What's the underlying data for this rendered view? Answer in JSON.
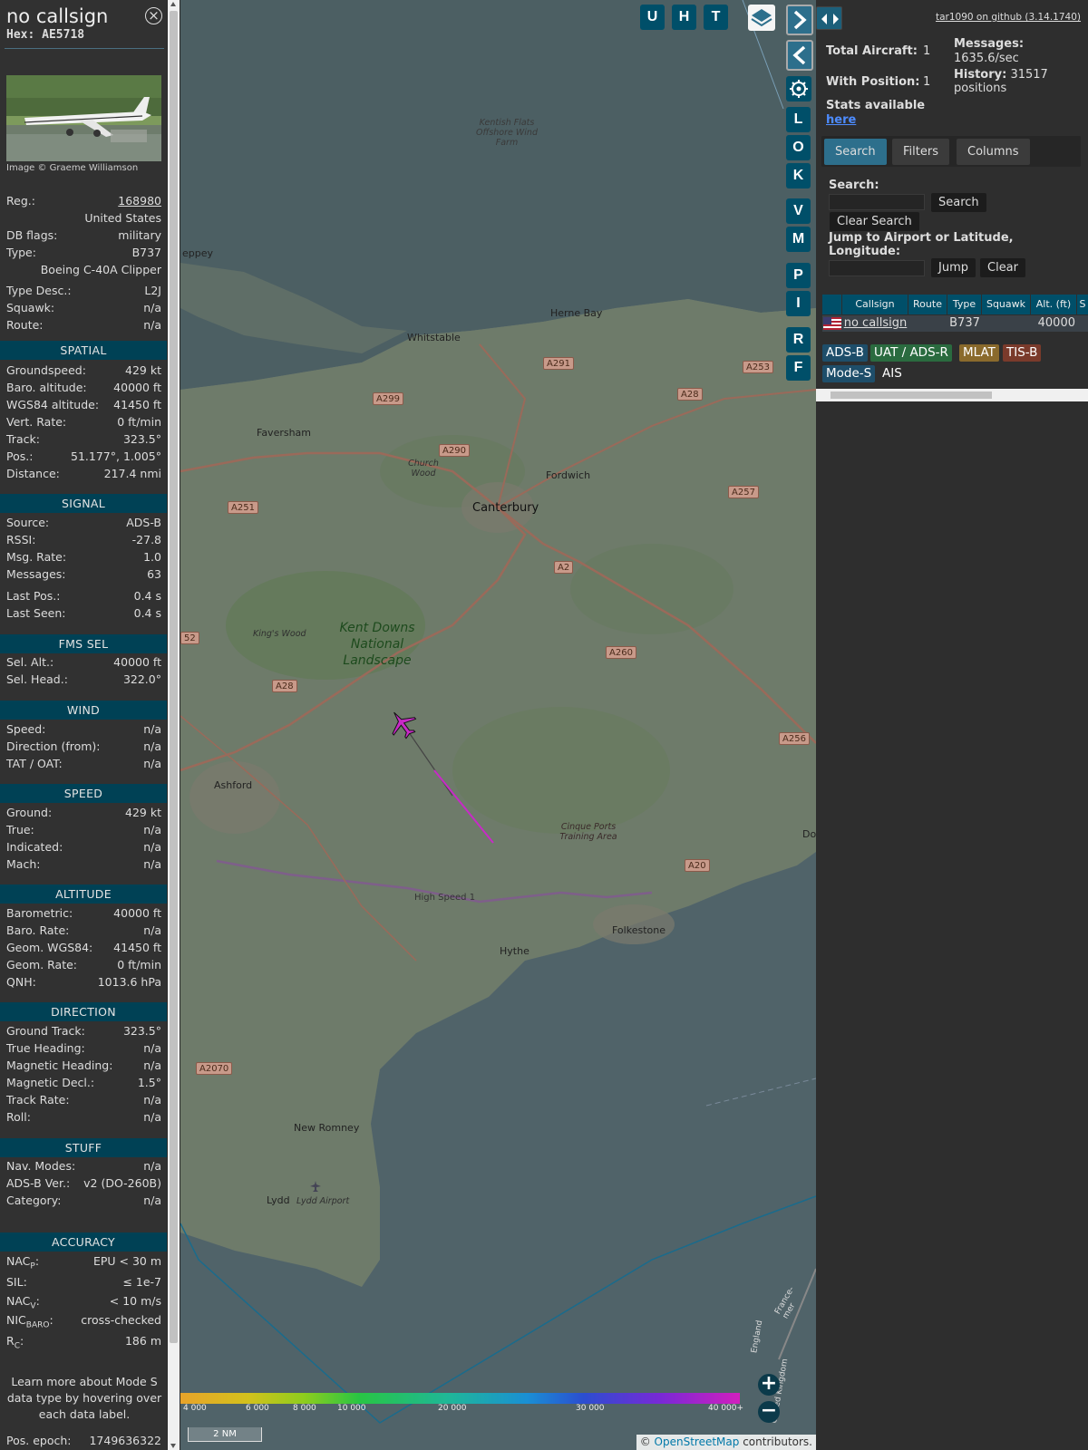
{
  "sidebar": {
    "callsign": "no callsign",
    "hex": "Hex: AE5718",
    "photo_credit": "Image © Graeme Williamson",
    "info": {
      "reg_label": "Reg.:",
      "reg": "168980",
      "country": "United States",
      "dbflags_label": "DB flags:",
      "dbflags": "military",
      "type_label": "Type:",
      "type": "B737",
      "type_full": "Boeing C-40A Clipper",
      "typedesc_label": "Type Desc.:",
      "typedesc": "L2J",
      "squawk_label": "Squawk:",
      "squawk": "n/a",
      "route_label": "Route:",
      "route": "n/a"
    },
    "sections": {
      "spatial": "SPATIAL",
      "signal": "SIGNAL",
      "fms": "FMS SEL",
      "wind": "WIND",
      "speed": "SPEED",
      "altitude": "ALTITUDE",
      "direction": "DIRECTION",
      "stuff": "STUFF",
      "accuracy": "ACCURACY"
    },
    "spatial": [
      [
        "Groundspeed:",
        "429 kt"
      ],
      [
        "Baro. altitude:",
        "40000 ft"
      ],
      [
        "WGS84 altitude:",
        "41450 ft"
      ],
      [
        "Vert. Rate:",
        "0 ft/min"
      ],
      [
        "Track:",
        "323.5°"
      ],
      [
        "Pos.:",
        "51.177°, 1.005°"
      ],
      [
        "Distance:",
        "217.4 nmi"
      ]
    ],
    "signal": [
      [
        "Source:",
        "ADS-B"
      ],
      [
        "RSSI:",
        "-27.8"
      ],
      [
        "Msg. Rate:",
        "1.0"
      ],
      [
        "Messages:",
        "63"
      ],
      [
        "Last Pos.:",
        "0.4 s"
      ],
      [
        "Last Seen:",
        "0.4 s"
      ]
    ],
    "fms": [
      [
        "Sel. Alt.:",
        "40000 ft"
      ],
      [
        "Sel. Head.:",
        "322.0°"
      ]
    ],
    "wind": [
      [
        "Speed:",
        "n/a"
      ],
      [
        "Direction (from):",
        "n/a"
      ],
      [
        "TAT / OAT:",
        "n/a"
      ]
    ],
    "speed": [
      [
        "Ground:",
        "429 kt"
      ],
      [
        "True:",
        "n/a"
      ],
      [
        "Indicated:",
        "n/a"
      ],
      [
        "Mach:",
        "n/a"
      ]
    ],
    "altitude": [
      [
        "Barometric:",
        "40000 ft"
      ],
      [
        "Baro. Rate:",
        "n/a"
      ],
      [
        "Geom. WGS84:",
        "41450 ft"
      ],
      [
        "Geom. Rate:",
        "0 ft/min"
      ],
      [
        "QNH:",
        "1013.6 hPa"
      ]
    ],
    "direction": [
      [
        "Ground Track:",
        "323.5°"
      ],
      [
        "True Heading:",
        "n/a"
      ],
      [
        "Magnetic Heading:",
        "n/a"
      ],
      [
        "Magnetic Decl.:",
        "1.5°"
      ],
      [
        "Track Rate:",
        "n/a"
      ],
      [
        "Roll:",
        "n/a"
      ]
    ],
    "stuff": [
      [
        "Nav. Modes:",
        "n/a"
      ],
      [
        "ADS-B Ver.:",
        "v2 (DO-260B)"
      ],
      [
        "Category:",
        "n/a"
      ]
    ],
    "accuracy": [
      [
        "NAC",
        "P",
        ":",
        "EPU < 30 m"
      ],
      [
        "SIL:",
        "",
        "",
        "≤ 1e-7"
      ],
      [
        "NAC",
        "V",
        ":",
        "< 10 m/s"
      ],
      [
        "NIC",
        "BARO",
        ":",
        "cross-checked"
      ],
      [
        "R",
        "C",
        ":",
        "186 m"
      ]
    ],
    "learn_more": "Learn more about Mode S data type by hovering over each data label.",
    "pos_epoch_label": "Pos. epoch:",
    "pos_epoch": "1749636322"
  },
  "map": {
    "buttons_top": [
      "U",
      "H",
      "T"
    ],
    "buttons_side": [
      "L",
      "O",
      "K",
      "V",
      "M",
      "P",
      "I",
      "R",
      "F"
    ],
    "labels": {
      "kentish_flats": "Kentish Flats Offshore Wind Farm",
      "sheppey": "eppey",
      "herne_bay": "Herne Bay",
      "whitstable": "Whitstable",
      "faversham": "Faversham",
      "church_wood": "Church Wood",
      "fordwich": "Fordwich",
      "canterbury": "Canterbury",
      "kings_wood": "King's Wood",
      "kent_downs": "Kent Downs National Landscape",
      "ashford": "Ashford",
      "cinque_ports": "Cinque Ports Training Area",
      "high_speed": "High Speed 1",
      "hythe": "Hythe",
      "folkestone": "Folkestone",
      "new_romney": "New Romney",
      "lydd": "Lydd",
      "lydd_airport": "Lydd Airport",
      "dov": "Dov",
      "england": "England",
      "united_kingdom": "United Kingdom",
      "france": "France-mer"
    },
    "roads": [
      "A291",
      "A299",
      "A290",
      "A28",
      "A253",
      "A257",
      "A251",
      "A2",
      "A260",
      "A28",
      "A256",
      "A20",
      "A2070",
      "52"
    ],
    "colorbar_ticks": [
      "4 000",
      "6 000",
      "8 000",
      "10 000",
      "20 000",
      "30 000",
      "40 000+"
    ],
    "scale": "2 NM",
    "osm_prefix": "©",
    "osm_link": "OpenStreetMap",
    "osm_suffix": "contributors."
  },
  "right": {
    "github": "tar1090 on github (3.14.1740)",
    "total_aircraft_label": "Total Aircraft:",
    "total_aircraft": "1",
    "with_position_label": "With Position:",
    "with_position": "1",
    "messages_label": "Messages:",
    "messages": "1635.6/sec",
    "history_label": "History:",
    "history": "31517 positions",
    "stats_label": "Stats available",
    "stats_link": "here",
    "tabs": [
      "Search",
      "Filters",
      "Columns"
    ],
    "search_label": "Search:",
    "search_btn": "Search",
    "clear_search_btn": "Clear Search",
    "jump_label": "Jump to Airport or Latitude, Longitude:",
    "jump_btn": "Jump",
    "clear_btn": "Clear",
    "table_headers": [
      "Callsign",
      "Route",
      "Type",
      "Squawk",
      "Alt. (ft)",
      "S"
    ],
    "table_row": {
      "callsign": "no callsign",
      "route": "",
      "type": "B737",
      "squawk": "",
      "alt": "40000"
    },
    "sources": [
      "ADS-B",
      "UAT / ADS-R",
      "MLAT",
      "TIS-B",
      "Mode-S",
      "AIS"
    ],
    "source_colors": [
      "#1e4e6a",
      "#2a6b3f",
      "#8a6a2c",
      "#7a3a2b",
      "#1e4e6a",
      "#2e2e2e"
    ]
  }
}
